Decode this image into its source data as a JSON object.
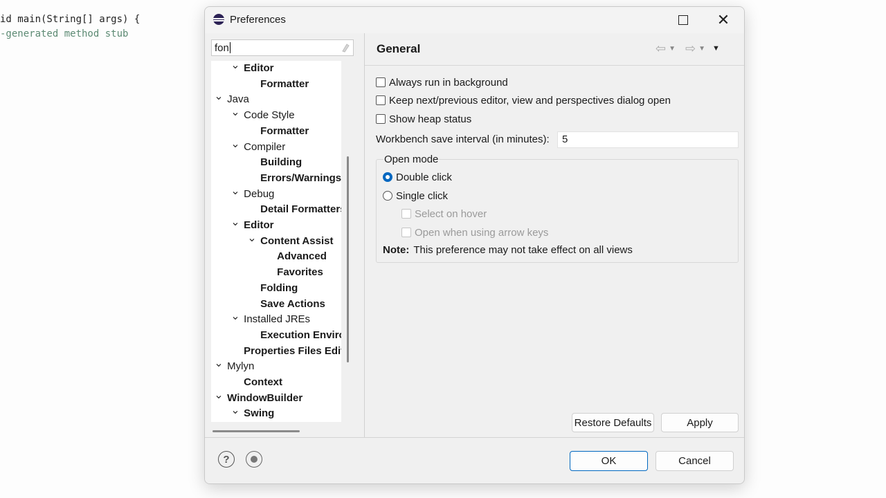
{
  "editor": {
    "line1_code": "id main(String[] args) {",
    "line2_comment": "-generated method stub"
  },
  "dialog": {
    "title": "Preferences",
    "icon": "eclipse-icon",
    "window_controls": {
      "maximize_icon": "maximize-icon",
      "close_glyph": "✕"
    }
  },
  "filter": {
    "value": "fon",
    "clear_icon": "eraser-icon"
  },
  "tree": [
    {
      "label": "Editor",
      "bold": true,
      "expanded": true,
      "level": 1
    },
    {
      "label": "Formatter",
      "bold": true,
      "expanded": null,
      "level": 2
    },
    {
      "label": "Java",
      "bold": false,
      "expanded": true,
      "level": 0
    },
    {
      "label": "Code Style",
      "bold": false,
      "expanded": true,
      "level": 1
    },
    {
      "label": "Formatter",
      "bold": true,
      "expanded": null,
      "level": 2
    },
    {
      "label": "Compiler",
      "bold": false,
      "expanded": true,
      "level": 1
    },
    {
      "label": "Building",
      "bold": true,
      "expanded": null,
      "level": 2
    },
    {
      "label": "Errors/Warnings",
      "bold": true,
      "expanded": null,
      "level": 2
    },
    {
      "label": "Debug",
      "bold": false,
      "expanded": true,
      "level": 1
    },
    {
      "label": "Detail Formatters",
      "bold": true,
      "expanded": null,
      "level": 2
    },
    {
      "label": "Editor",
      "bold": true,
      "expanded": true,
      "level": 1
    },
    {
      "label": "Content Assist",
      "bold": true,
      "expanded": true,
      "level": 2
    },
    {
      "label": "Advanced",
      "bold": true,
      "expanded": null,
      "level": 3
    },
    {
      "label": "Favorites",
      "bold": true,
      "expanded": null,
      "level": 3
    },
    {
      "label": "Folding",
      "bold": true,
      "expanded": null,
      "level": 2
    },
    {
      "label": "Save Actions",
      "bold": true,
      "expanded": null,
      "level": 2
    },
    {
      "label": "Installed JREs",
      "bold": false,
      "expanded": true,
      "level": 1
    },
    {
      "label": "Execution Environments",
      "bold": true,
      "expanded": null,
      "level": 2
    },
    {
      "label": "Properties Files Editor",
      "bold": true,
      "expanded": null,
      "level": 1
    },
    {
      "label": "Mylyn",
      "bold": false,
      "expanded": true,
      "level": 0
    },
    {
      "label": "Context",
      "bold": true,
      "expanded": null,
      "level": 1
    },
    {
      "label": "WindowBuilder",
      "bold": true,
      "expanded": true,
      "level": 0
    },
    {
      "label": "Swing",
      "bold": true,
      "expanded": true,
      "level": 1
    }
  ],
  "page": {
    "title": "General",
    "checkboxes": [
      {
        "label": "Always run in background",
        "checked": false
      },
      {
        "label": "Keep next/previous editor, view and perspectives dialog open",
        "checked": false
      },
      {
        "label": "Show heap status",
        "checked": false
      }
    ],
    "interval_label": "Workbench save interval (in minutes):",
    "interval_value": "5",
    "open_mode": {
      "title": "Open mode",
      "options": [
        {
          "label": "Double click",
          "selected": true
        },
        {
          "label": "Single click",
          "selected": false
        }
      ],
      "sub_options": [
        {
          "label": "Select on hover",
          "enabled": false
        },
        {
          "label": "Open when using arrow keys",
          "enabled": false
        }
      ],
      "note_label": "Note:",
      "note_text": "This preference may not take effect on all views"
    },
    "restore_defaults": "Restore Defaults",
    "apply": "Apply"
  },
  "footer": {
    "help_glyph": "?",
    "ok": "OK",
    "cancel": "Cancel"
  },
  "colors": {
    "accent": "#0067c0",
    "dialog_bg": "#f0f0f0"
  }
}
